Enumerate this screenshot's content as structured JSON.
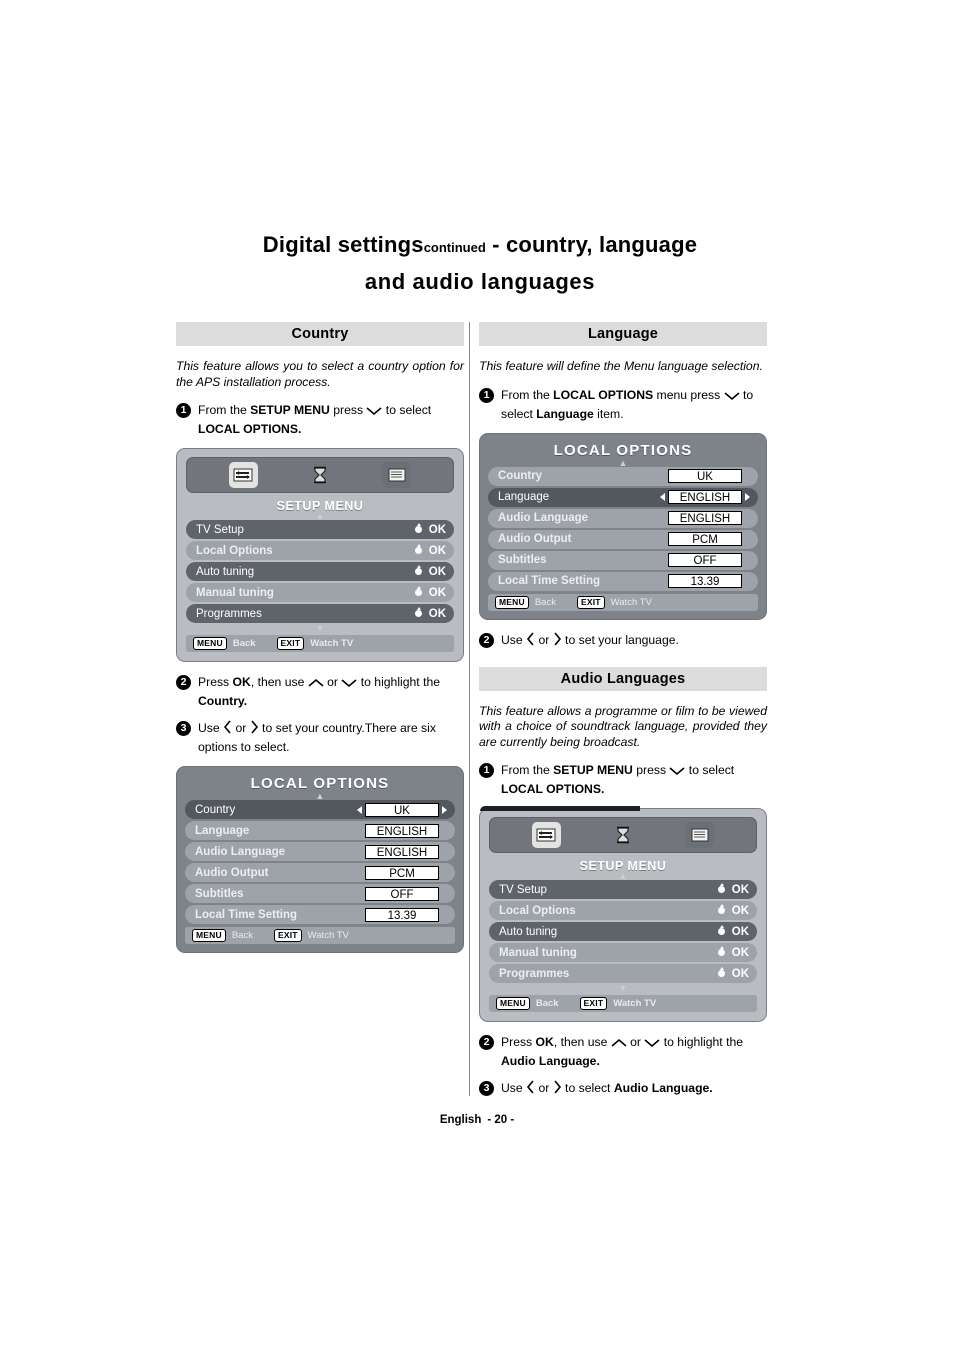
{
  "page": {
    "title_main": "Digital settings",
    "title_continued": "continued",
    "title_rest": "- country, language",
    "title_line2": "and audio languages",
    "footer_language": "English",
    "footer_page": "- 20 -"
  },
  "osd_common": {
    "setup_title": "SETUP MENU",
    "local_title": "LOCAL OPTIONS",
    "ok_label": "OK",
    "menu_key": "MENU",
    "menu_action": "Back",
    "exit_key": "EXIT",
    "exit_action": "Watch TV",
    "icons": [
      "tv-setup-icon",
      "hourglass-tuning-icon",
      "programmes-list-icon"
    ],
    "setup_rows": [
      {
        "label": "TV Setup",
        "value": "OK"
      },
      {
        "label": "Local Options",
        "value": "OK"
      },
      {
        "label": "Auto tuning",
        "value": "OK"
      },
      {
        "label": "Manual tuning",
        "value": "OK"
      },
      {
        "label": "Programmes",
        "value": "OK"
      }
    ],
    "local_rows": [
      {
        "label": "Country",
        "value": "UK"
      },
      {
        "label": "Language",
        "value": "ENGLISH"
      },
      {
        "label": "Audio Language",
        "value": "ENGLISH"
      },
      {
        "label": "Audio Output",
        "value": "PCM"
      },
      {
        "label": "Subtitles",
        "value": "OFF"
      },
      {
        "label": "Local Time Setting",
        "value": "13.39"
      }
    ]
  },
  "country_section": {
    "heading": "Country",
    "intro": "This feature allows you to select a country option for the APS installation process.",
    "step1_pre": "From the ",
    "step1_b1": "SETUP MENU",
    "step1_mid": " press ",
    "step1_post": " to select ",
    "step1_b2": "LOCAL OPTIONS.",
    "step2_pre": "Press ",
    "step2_b1": "OK",
    "step2_mid": ", then use ",
    "step2_or": " or ",
    "step2_post": " to highlight the ",
    "step2_b2": "Country.",
    "step3_pre": "Use ",
    "step3_or": " or ",
    "step3_post": " to set your country.There are six options to select.",
    "selected_row": "Country",
    "highlight_index": 1
  },
  "language_section": {
    "heading": "Language",
    "intro": "This feature will define the Menu language selection.",
    "step1_pre": "From the ",
    "step1_b1": "LOCAL OPTIONS",
    "step1_mid": " menu press ",
    "step1_post": " to select ",
    "step1_b2": "Language",
    "step1_tail": " item.",
    "step2_pre": "Use ",
    "step2_or": " or ",
    "step2_post": " to set your language.",
    "highlight_index": 1
  },
  "audio_section": {
    "heading": "Audio Languages",
    "intro": "This feature allows a programme or film to be viewed with a choice of soundtrack language, provided they are currently being broadcast.",
    "step1_pre": "From the ",
    "step1_b1": "SETUP MENU",
    "step1_mid": " press ",
    "step1_post": " to select ",
    "step1_b2": "LOCAL OPTIONS.",
    "step2_pre": "Press ",
    "step2_b1": "OK",
    "step2_mid": ", then use ",
    "step2_or": " or ",
    "step2_post": " to highlight the ",
    "step2_b2": "Audio Language.",
    "step3_pre": "Use ",
    "step3_or": " or ",
    "step3_post": " to select ",
    "step3_b1": "Audio Language."
  },
  "step_numbers": {
    "one": "1",
    "two": "2",
    "three": "3"
  }
}
